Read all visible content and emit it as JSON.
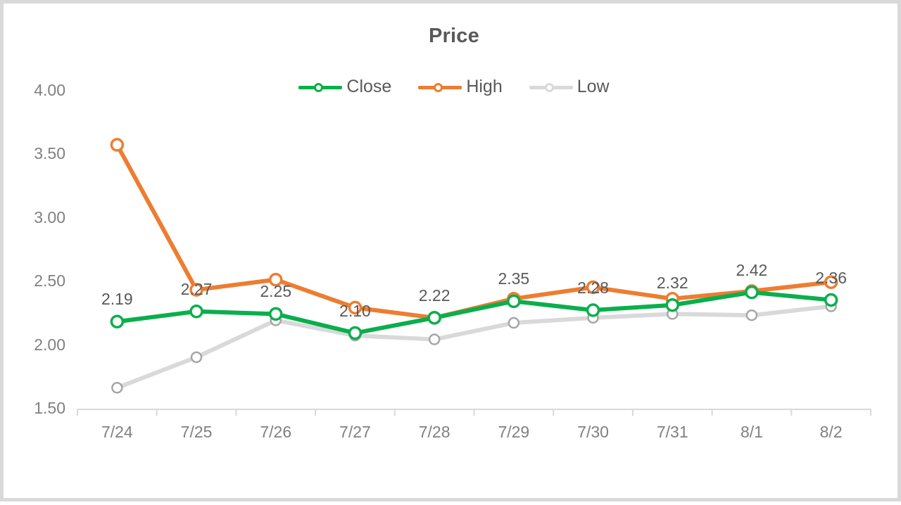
{
  "chart_data": {
    "type": "line",
    "title": "Price",
    "xlabel": "",
    "ylabel": "",
    "grid": false,
    "legend_position": "top-center",
    "categories": [
      "7/24",
      "7/25",
      "7/26",
      "7/27",
      "7/28",
      "7/29",
      "7/30",
      "7/31",
      "8/1",
      "8/2"
    ],
    "ylim": [
      1.5,
      4.0
    ],
    "ytick_labels": [
      "4.00",
      "3.50",
      "3.00",
      "2.50",
      "2.00",
      "1.50"
    ],
    "yticks": [
      4.0,
      3.5,
      3.0,
      2.5,
      2.0,
      1.5
    ],
    "series": [
      {
        "name": "Close",
        "color": "#09af4c",
        "values": [
          2.19,
          2.27,
          2.25,
          2.1,
          2.22,
          2.35,
          2.28,
          2.32,
          2.42,
          2.36
        ],
        "data_labels": [
          "2.19",
          "2.27",
          "2.25",
          "2.10",
          "2.22",
          "2.35",
          "2.28",
          "2.32",
          "2.42",
          "2.36"
        ]
      },
      {
        "name": "High",
        "color": "#ed7d31",
        "values": [
          3.58,
          2.44,
          2.52,
          2.3,
          2.22,
          2.37,
          2.46,
          2.37,
          2.43,
          2.5
        ],
        "data_labels": null
      },
      {
        "name": "Low",
        "color": "#d9d9d9",
        "values": [
          1.67,
          1.91,
          2.2,
          2.08,
          2.05,
          2.18,
          2.22,
          2.25,
          2.24,
          2.31
        ],
        "data_labels": null
      }
    ],
    "axis_line_color": "#d9d9d9",
    "text_color": "#595959",
    "tick_text_color": "#808080"
  }
}
